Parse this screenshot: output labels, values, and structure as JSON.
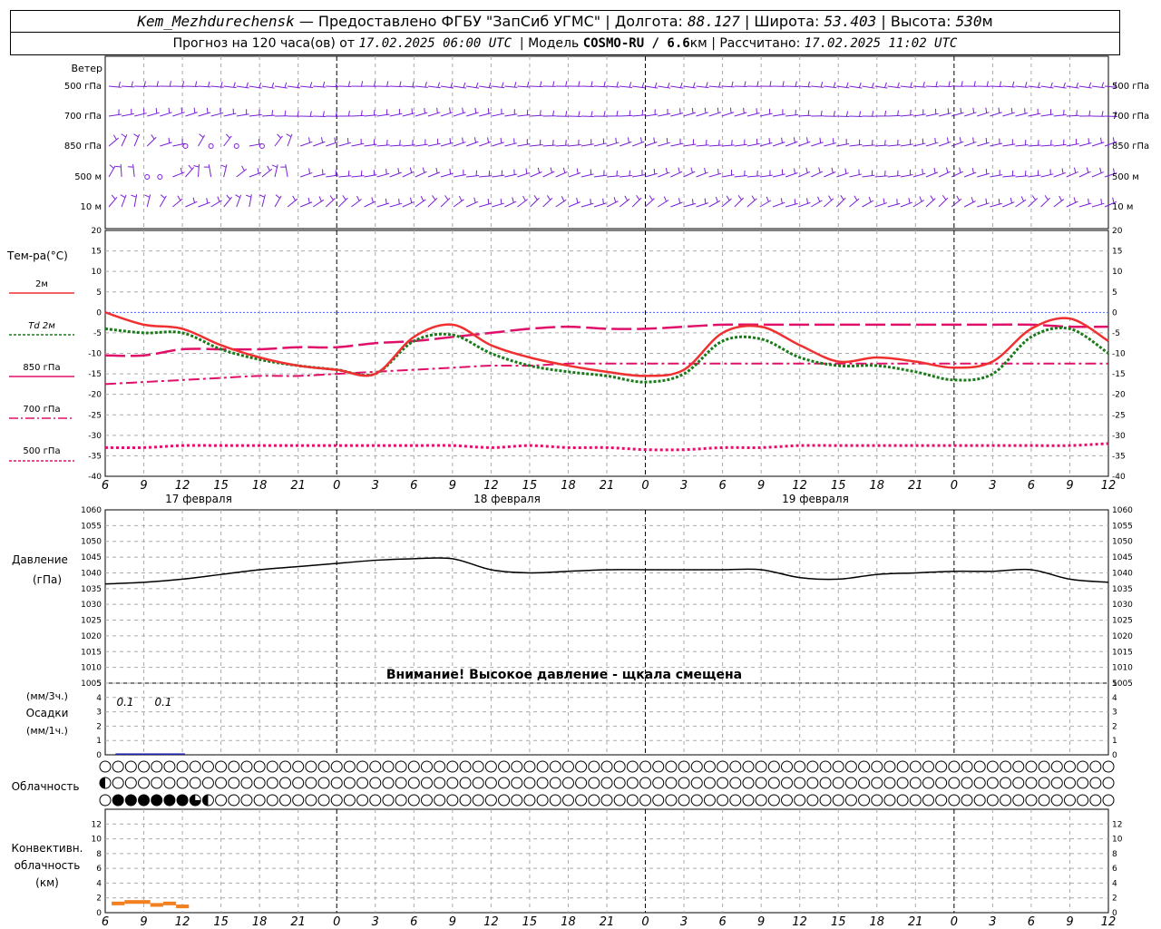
{
  "header": {
    "station": "Kem_Mezhdurechensk",
    "provider": "— Предоставлено ФГБУ \"ЗапСиб УГМС\" |",
    "lon_label": "Долгота:",
    "lon": "88.127",
    "lat_label": "| Широта:",
    "lat": "53.403",
    "alt_label": "| Высота:",
    "alt": "530",
    "alt_unit": "м",
    "forecast_label": "Прогноз на 120 часа(ов) от",
    "forecast_time": "17.02.2025 06:00 UTC",
    "model_label": "| Модель",
    "model": "COSMO-RU / 6.6",
    "model_unit": "км",
    "calc_label": "| Рассчитано:",
    "calc_time": "17.02.2025 11:02 UTC"
  },
  "wind_panel": {
    "title": "Ветер",
    "levels": [
      "500 гПа",
      "700 гПа",
      "850 гПа",
      "500 м",
      "10 м"
    ]
  },
  "temp_panel": {
    "title": "Тем-ра(°C)",
    "legend": [
      "2м",
      "Td 2м",
      "850 гПа",
      "700 гПа",
      "500 гПа"
    ]
  },
  "pressure_panel": {
    "title": "Давление",
    "unit": "(гПа)",
    "warning": "Внимание! Высокое давление - щкала смещена"
  },
  "precip_panel": {
    "label_top": "(мм/3ч.)",
    "label_mid": "Осадки",
    "label_bot": "(мм/1ч.)",
    "annotations": [
      "0.1",
      "0.1"
    ]
  },
  "cloud_panel": {
    "title": "Облачность"
  },
  "conv_panel": {
    "label1": "Конвективн.",
    "label2": "облачность",
    "label3": "(км)"
  },
  "time_axis": {
    "hour_labels": [
      "6",
      "9",
      "12",
      "15",
      "18",
      "21",
      "0",
      "3",
      "6",
      "9",
      "12",
      "15",
      "18",
      "21",
      "0",
      "3",
      "6",
      "9",
      "12",
      "15",
      "18",
      "21",
      "0",
      "3",
      "6",
      "9",
      "12"
    ],
    "date_labels": [
      "17 февраля",
      "18 февраля",
      "19 февраля"
    ]
  },
  "colors": {
    "wind": "#7a1fd6",
    "t2m": "#f03030",
    "td2m": "#1a7a1a",
    "t850": "#e0106a",
    "t700": "#e0106a",
    "t500": "#e0106a",
    "pressure": "#000000",
    "precip": "#2020b0",
    "convective": "#f08020",
    "grid": "#aaaaaa"
  },
  "chart_data": [
    {
      "type": "line",
      "panel": "temperature",
      "xlabel": "",
      "ylabel": "Тем-ра(°C)",
      "ylim": [
        -40,
        20
      ],
      "yticks": [
        20,
        15,
        10,
        5,
        0,
        -5,
        -10,
        -15,
        -20,
        -25,
        -30,
        -35,
        -40
      ],
      "x_hours": [
        0,
        3,
        6,
        9,
        12,
        15,
        18,
        21,
        24,
        27,
        30,
        33,
        36,
        39,
        42,
        45,
        48,
        51,
        54,
        57,
        60,
        63,
        66,
        69,
        72,
        75,
        78
      ],
      "series": [
        {
          "name": "2м",
          "values": [
            0,
            -3,
            -4,
            -8,
            -11,
            -13,
            -14,
            -15,
            -6,
            -3,
            -8,
            -11,
            -13,
            -14.5,
            -15.5,
            -14,
            -5,
            -3.5,
            -8,
            -12,
            -11,
            -12,
            -13.5,
            -12,
            -4,
            -1.5,
            -7
          ]
        },
        {
          "name": "Td 2м",
          "values": [
            -4,
            -5,
            -5,
            -9,
            -11.5,
            -13,
            -14,
            -15,
            -7,
            -5.5,
            -10,
            -13,
            -14.5,
            -15.5,
            -17,
            -15,
            -7,
            -6.5,
            -11,
            -13,
            -13,
            -14.5,
            -16.5,
            -15,
            -6,
            -4,
            -10
          ]
        },
        {
          "name": "850 гПа",
          "values": [
            -10.5,
            -10.5,
            -9,
            -9,
            -9,
            -8.5,
            -8.5,
            -7.5,
            -7,
            -6,
            -5,
            -4,
            -3.5,
            -4,
            -4,
            -3.5,
            -3,
            -3,
            -3,
            -3,
            -3,
            -3,
            -3,
            -3,
            -3,
            -3.5,
            -3.5
          ]
        },
        {
          "name": "700 гПа",
          "values": [
            -17.5,
            -17,
            -16.5,
            -16,
            -15.5,
            -15.5,
            -15,
            -14.5,
            -14,
            -13.5,
            -13,
            -13,
            -12.5,
            -12.5,
            -12.5,
            -12.5,
            -12.5,
            -12.5,
            -12.5,
            -12.5,
            -12.5,
            -12.5,
            -12.5,
            -12.5,
            -12.5,
            -12.5,
            -12.5
          ]
        },
        {
          "name": "500 гПа",
          "values": [
            -33,
            -33,
            -32.5,
            -32.5,
            -32.5,
            -32.5,
            -32.5,
            -32.5,
            -32.5,
            -32.5,
            -33,
            -32.5,
            -33,
            -33,
            -33.5,
            -33.5,
            -33,
            -33,
            -32.5,
            -32.5,
            -32.5,
            -32.5,
            -32.5,
            -32.5,
            -32.5,
            -32.5,
            -32
          ]
        }
      ]
    },
    {
      "type": "line",
      "panel": "pressure",
      "ylabel": "Давление (гПа)",
      "ylim": [
        1005,
        1060
      ],
      "yticks": [
        1060,
        1055,
        1050,
        1045,
        1040,
        1035,
        1030,
        1025,
        1020,
        1015,
        1010,
        1005
      ],
      "x_hours": [
        0,
        3,
        6,
        9,
        12,
        15,
        18,
        21,
        24,
        27,
        30,
        33,
        36,
        39,
        42,
        45,
        48,
        51,
        54,
        57,
        60,
        63,
        66,
        69,
        72,
        75,
        78
      ],
      "series": [
        {
          "name": "Давление",
          "values": [
            1036.5,
            1037,
            1038,
            1039.5,
            1041,
            1042,
            1043,
            1044,
            1044.5,
            1044.5,
            1041,
            1040,
            1040.5,
            1041,
            1041,
            1041,
            1041,
            1041,
            1038.5,
            1038,
            1039.5,
            1040,
            1040.5,
            1040.5,
            1041,
            1038,
            1037
          ]
        }
      ]
    },
    {
      "type": "bar",
      "panel": "precipitation",
      "ylabel": "Осадки",
      "ylim": [
        0,
        5
      ],
      "yticks": [
        5,
        4,
        3,
        2,
        1,
        0
      ],
      "x_hours": [
        0,
        3,
        6
      ],
      "values": [
        0.1,
        0.1,
        0
      ]
    },
    {
      "type": "bar",
      "panel": "convective_cloud",
      "ylabel": "Конвективн. облачность (км)",
      "ylim": [
        0,
        14
      ],
      "yticks": [
        12,
        10,
        8,
        6,
        4,
        2,
        0
      ],
      "segments": [
        {
          "x_start": 0.5,
          "x_end": 1.5,
          "top_km": 1.5
        },
        {
          "x_start": 1.5,
          "x_end": 3.5,
          "top_km": 1.7
        },
        {
          "x_start": 3.5,
          "x_end": 4.5,
          "top_km": 1.3
        },
        {
          "x_start": 4.5,
          "x_end": 5.5,
          "top_km": 1.5
        },
        {
          "x_start": 5.5,
          "x_end": 6.5,
          "top_km": 1.1
        }
      ]
    }
  ],
  "clouds": {
    "rows": 3,
    "row1_fill": "clear",
    "row2_special": [
      {
        "index": 0,
        "fill": "half"
      }
    ],
    "row3_special": [
      {
        "index": 1,
        "fill": "full"
      },
      {
        "index": 2,
        "fill": "full"
      },
      {
        "index": 3,
        "fill": "full"
      },
      {
        "index": 4,
        "fill": "full"
      },
      {
        "index": 5,
        "fill": "full"
      },
      {
        "index": 6,
        "fill": "full"
      },
      {
        "index": 7,
        "fill": "three-quarter"
      },
      {
        "index": 8,
        "fill": "half"
      }
    ]
  }
}
